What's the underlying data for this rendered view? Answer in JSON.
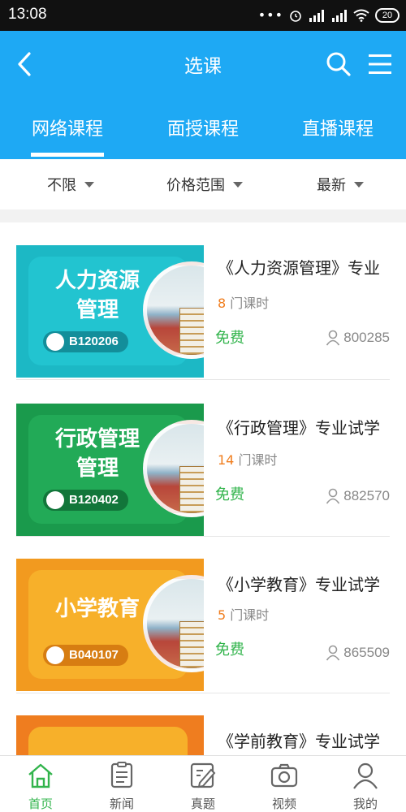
{
  "status_bar": {
    "time": "13:08",
    "battery": "20"
  },
  "header": {
    "title": "选课"
  },
  "tabs": [
    {
      "label": "网络课程",
      "active": true
    },
    {
      "label": "面授课程",
      "active": false
    },
    {
      "label": "直播课程",
      "active": false
    }
  ],
  "filters": [
    {
      "label": "不限"
    },
    {
      "label": "价格范围"
    },
    {
      "label": "最新"
    }
  ],
  "courses": [
    {
      "thumb_title": "人力资源管理",
      "thumb_line1": "人力资源",
      "thumb_line2": "管理",
      "code": "B120206",
      "title": "《人力资源管理》专业",
      "lessons": "8",
      "lessons_unit": "门课时",
      "price": "免费",
      "students": "800285",
      "theme": "teal"
    },
    {
      "thumb_title": "行政管理管理",
      "thumb_line1": "行政管理",
      "thumb_line2": "管理",
      "code": "B120402",
      "title": "《行政管理》专业试学",
      "lessons": "14",
      "lessons_unit": "门课时",
      "price": "免费",
      "students": "882570",
      "theme": "green"
    },
    {
      "thumb_title": "小学教育",
      "thumb_line1": "小学教育",
      "thumb_line2": "",
      "code": "B040107",
      "title": "《小学教育》专业试学",
      "lessons": "5",
      "lessons_unit": "门课时",
      "price": "免费",
      "students": "865509",
      "theme": "orange"
    },
    {
      "thumb_title": "",
      "thumb_line1": "",
      "thumb_line2": "",
      "code": "",
      "title": "《学前教育》专业试学",
      "lessons": "",
      "lessons_unit": "",
      "price": "",
      "students": "",
      "theme": "orange2"
    }
  ],
  "bottom_nav": [
    {
      "label": "首页",
      "icon": "home-icon",
      "active": true
    },
    {
      "label": "新闻",
      "icon": "news-icon",
      "active": false
    },
    {
      "label": "真题",
      "icon": "exam-icon",
      "active": false
    },
    {
      "label": "视频",
      "icon": "camera-icon",
      "active": false
    },
    {
      "label": "我的",
      "icon": "profile-icon",
      "active": false
    }
  ],
  "colors": {
    "header_blue": "#1ea9f4",
    "active_green": "#32b44c",
    "lesson_orange": "#f07d1e",
    "teal_bg": "#1cb8c5",
    "green_bg": "#1a9a4c",
    "orange_bg": "#f29a1f"
  }
}
